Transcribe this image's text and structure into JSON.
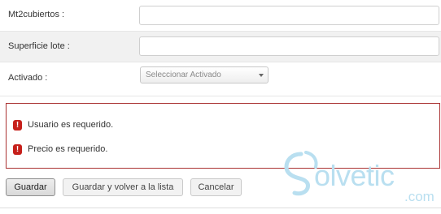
{
  "form": {
    "fields": [
      {
        "label": "Mt2cubiertos :",
        "value": ""
      },
      {
        "label": "Superficie lote :",
        "value": ""
      },
      {
        "label": "Activado :",
        "select_value": "Seleccionar Activado"
      }
    ]
  },
  "errors": [
    {
      "icon": "exclamation-icon",
      "message": "Usuario es requerido."
    },
    {
      "icon": "exclamation-icon",
      "message": "Precio es requerido."
    }
  ],
  "buttons": {
    "save": "Guardar",
    "save_return": "Guardar y volver a la lista",
    "cancel": "Cancelar"
  },
  "watermark": {
    "brand": "olvetic",
    "suffix": ".com"
  },
  "colors": {
    "error_border": "#aa3333",
    "error_icon": "#c6201b",
    "watermark": "#b9dff0"
  }
}
